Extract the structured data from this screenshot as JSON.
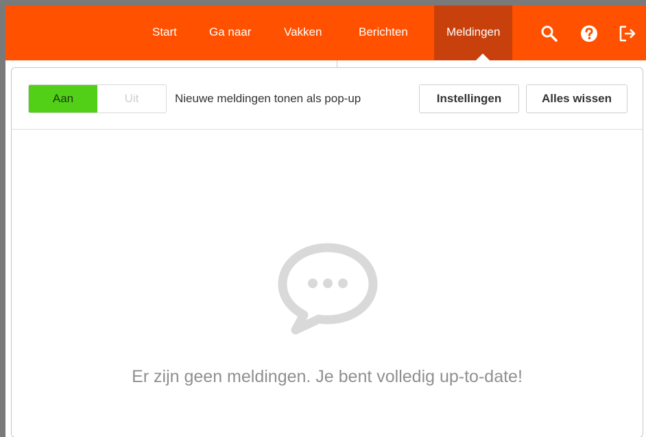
{
  "nav": {
    "items": [
      {
        "label": "Start"
      },
      {
        "label": "Ga naar"
      },
      {
        "label": "Vakken"
      },
      {
        "label": "Berichten"
      },
      {
        "label": "Meldingen"
      }
    ]
  },
  "icons": {
    "search": "search-icon",
    "help": "help-icon",
    "logout": "logout-icon"
  },
  "notifications": {
    "toggle_on_label": "Aan",
    "toggle_off_label": "Uit",
    "popup_label": "Nieuwe meldingen tonen als pop-up",
    "settings_button": "Instellingen",
    "clear_button": "Alles wissen",
    "empty_message": "Er zijn geen meldingen. Je bent volledig up-to-date!",
    "empty_icon": "speech-bubble-icon"
  },
  "colors": {
    "brand": "#ff5100",
    "active_nav": "#c8400b",
    "toggle_on": "#52d017"
  }
}
